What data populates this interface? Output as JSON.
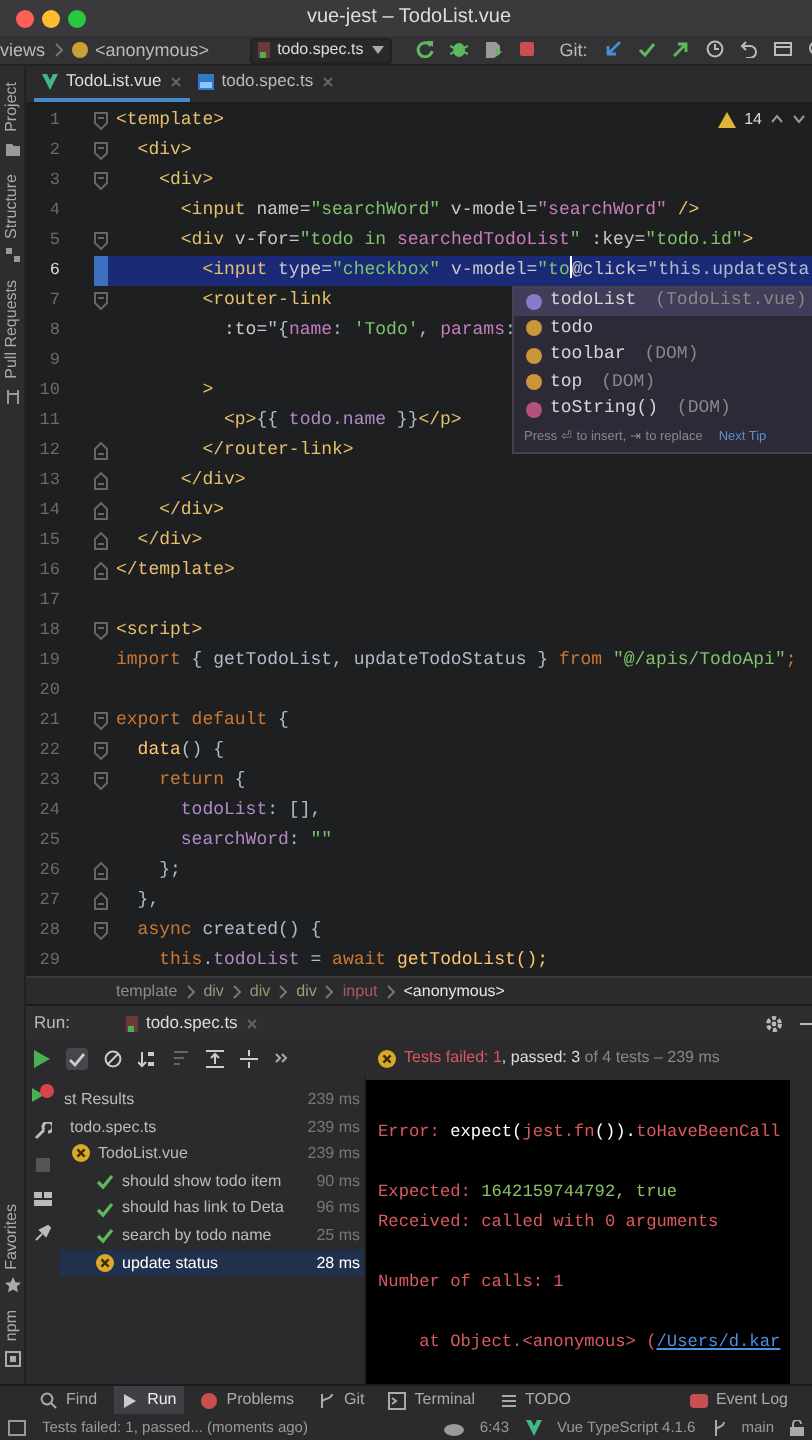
{
  "window": {
    "title": "vue-jest – TodoList.vue"
  },
  "toolbar": {
    "breadcrumb": [
      "views",
      "<anonymous>"
    ],
    "run_config": "todo.spec.ts",
    "git_label": "Git:"
  },
  "tool_strip": {
    "top": [
      "Project",
      "Structure",
      "Pull Requests"
    ],
    "bottom": [
      "Favorites",
      "npm"
    ]
  },
  "editor_tabs": [
    {
      "label": "TodoList.vue",
      "kind": "vue",
      "selected": true
    },
    {
      "label": "todo.spec.ts",
      "kind": "ts",
      "selected": false
    }
  ],
  "editor": {
    "warnings": "14",
    "lines": [
      {
        "number": "1",
        "kind": "fold-start",
        "current": false,
        "tokens": [
          {
            "text": "<template>",
            "kind": "tag"
          }
        ]
      },
      {
        "number": "2",
        "kind": "fold-start",
        "current": false,
        "tokens": [
          {
            "text": "  <div>",
            "kind": "tag"
          }
        ]
      },
      {
        "number": "3",
        "kind": "fold-start",
        "current": false,
        "tokens": [
          {
            "text": "    <div>",
            "kind": "tag"
          }
        ]
      },
      {
        "number": "4",
        "current": false,
        "tokens": [
          {
            "text": "      <input",
            "kind": "tag"
          },
          {
            "text": " name=",
            "kind": "attr"
          },
          {
            "text": "\"searchWord\"",
            "kind": "str"
          },
          {
            "text": " v-model=",
            "kind": "attr"
          },
          {
            "text": "\"searchWord\"",
            "kind": "bind"
          },
          {
            "text": " />",
            "kind": "tag"
          }
        ]
      },
      {
        "number": "5",
        "kind": "fold-start",
        "current": false,
        "tokens": [
          {
            "text": "      <div",
            "kind": "tag"
          },
          {
            "text": " v-for=",
            "kind": "attr"
          },
          {
            "text": "\"todo in ",
            "kind": "str"
          },
          {
            "text": "searchedTodoList",
            "kind": "bind"
          },
          {
            "text": "\"",
            "kind": "str"
          },
          {
            "text": " :key=",
            "kind": "attr"
          },
          {
            "text": "\"todo.id\"",
            "kind": "str"
          },
          {
            "text": ">",
            "kind": "tag"
          }
        ]
      },
      {
        "number": "6",
        "current": true,
        "tokens": [
          {
            "text": "        <input",
            "kind": "tag"
          },
          {
            "text": " type=",
            "kind": "attr"
          },
          {
            "text": "\"checkbox\"",
            "kind": "str"
          },
          {
            "text": " v-model=",
            "kind": "attr"
          },
          {
            "text": "\"to",
            "kind": "str"
          },
          {
            "kind": "caret"
          },
          {
            "text": "@click=",
            "kind": "attr"
          },
          {
            "text": "\"this.updateSta",
            "kind": "plain"
          }
        ]
      },
      {
        "number": "7",
        "kind": "fold-start",
        "current": false,
        "tokens": [
          {
            "text": "        <router-link",
            "kind": "tag"
          }
        ]
      },
      {
        "number": "8",
        "current": false,
        "tokens": [
          {
            "text": "          :to=",
            "kind": "attr"
          },
          {
            "text": "\"{",
            "kind": "plain"
          },
          {
            "text": "name",
            "kind": "bind"
          },
          {
            "text": ": ",
            "kind": "plain"
          },
          {
            "text": "'Todo'",
            "kind": "str"
          },
          {
            "text": ", ",
            "kind": "plain"
          },
          {
            "text": "params",
            "kind": "bind"
          },
          {
            "text": ":",
            "kind": "plain"
          }
        ]
      },
      {
        "number": "9",
        "current": false
      },
      {
        "number": "10",
        "current": false,
        "tokens": [
          {
            "text": "        >",
            "kind": "tag"
          }
        ]
      },
      {
        "number": "11",
        "current": false,
        "tokens": [
          {
            "text": "          <p>",
            "kind": "tag"
          },
          {
            "text": "{{ ",
            "kind": "plain"
          },
          {
            "text": "todo.name",
            "kind": "prop"
          },
          {
            "text": " }}",
            "kind": "plain"
          },
          {
            "text": "</p>",
            "kind": "tag"
          }
        ]
      },
      {
        "number": "12",
        "kind": "fold-end",
        "current": false,
        "tokens": [
          {
            "text": "        </router-link>",
            "kind": "tag"
          }
        ]
      },
      {
        "number": "13",
        "kind": "fold-end",
        "current": false,
        "tokens": [
          {
            "text": "      </div>",
            "kind": "tag"
          }
        ]
      },
      {
        "number": "14",
        "kind": "fold-end",
        "current": false,
        "tokens": [
          {
            "text": "    </div>",
            "kind": "tag"
          }
        ]
      },
      {
        "number": "15",
        "kind": "fold-end",
        "current": false,
        "tokens": [
          {
            "text": "  </div>",
            "kind": "tag"
          }
        ]
      },
      {
        "number": "16",
        "kind": "fold-end",
        "current": false,
        "tokens": [
          {
            "text": "</template>",
            "kind": "tag"
          }
        ]
      },
      {
        "number": "17",
        "current": false
      },
      {
        "number": "18",
        "kind": "fold-start",
        "current": false,
        "tokens": [
          {
            "text": "<script>",
            "kind": "tag"
          }
        ]
      },
      {
        "number": "19",
        "current": false,
        "tokens": [
          {
            "text": "import",
            "kind": "kw"
          },
          {
            "text": " { getTodoList, updateTodoStatus } ",
            "kind": "plain"
          },
          {
            "text": "from",
            "kind": "kw"
          },
          {
            "text": " \"@/apis/TodoApi\"",
            "kind": "str"
          },
          {
            "text": ";",
            "kind": "kw"
          }
        ]
      },
      {
        "number": "20",
        "current": false
      },
      {
        "number": "21",
        "kind": "fold-start",
        "current": false,
        "tokens": [
          {
            "text": "export default",
            "kind": "kw"
          },
          {
            "text": " {",
            "kind": "plain"
          }
        ]
      },
      {
        "number": "22",
        "kind": "fold-start",
        "current": false,
        "tokens": [
          {
            "text": "  data",
            "kind": "fn"
          },
          {
            "text": "() {",
            "kind": "plain"
          }
        ]
      },
      {
        "number": "23",
        "kind": "fold-start",
        "current": false,
        "tokens": [
          {
            "text": "    return",
            "kind": "kw"
          },
          {
            "text": " {",
            "kind": "plain"
          }
        ]
      },
      {
        "number": "24",
        "current": false,
        "tokens": [
          {
            "text": "      todoList",
            "kind": "prop"
          },
          {
            "text": ": [],",
            "kind": "plain"
          }
        ]
      },
      {
        "number": "25",
        "current": false,
        "tokens": [
          {
            "text": "      searchWord",
            "kind": "prop"
          },
          {
            "text": ": ",
            "kind": "plain"
          },
          {
            "text": "\"\"",
            "kind": "str"
          }
        ]
      },
      {
        "number": "26",
        "kind": "fold-end",
        "current": false,
        "tokens": [
          {
            "text": "    };",
            "kind": "plain"
          }
        ]
      },
      {
        "number": "27",
        "kind": "fold-end",
        "current": false,
        "tokens": [
          {
            "text": "  },",
            "kind": "plain"
          }
        ]
      },
      {
        "number": "28",
        "kind": "fold-start",
        "current": false,
        "tokens": [
          {
            "text": "  async",
            "kind": "kw"
          },
          {
            "text": " created() {",
            "kind": "plain"
          }
        ]
      },
      {
        "number": "29",
        "current": false,
        "tokens": [
          {
            "text": "    this",
            "kind": "kw"
          },
          {
            "text": ".",
            "kind": "plain"
          },
          {
            "text": "todoList",
            "kind": "prop"
          },
          {
            "text": " = ",
            "kind": "plain"
          },
          {
            "text": "await",
            "kind": "kw"
          },
          {
            "text": " getTodoList();",
            "kind": "fn"
          }
        ]
      }
    ],
    "autocomplete": {
      "items": [
        {
          "label": "todoList",
          "detail": "(TodoList.vue)",
          "kind": "property",
          "selected": true
        },
        {
          "label": "todo",
          "kind": "variable",
          "selected": false
        },
        {
          "label": "toolbar",
          "detail": "(DOM)",
          "kind": "variable",
          "selected": false
        },
        {
          "label": "top",
          "detail": "(DOM)",
          "kind": "variable",
          "selected": false
        },
        {
          "label": "toString()",
          "detail": "(DOM)",
          "kind": "method",
          "selected": false
        }
      ],
      "hint": "Press ⏎ to insert, ⇥ to replace",
      "tip_link": "Next Tip"
    }
  },
  "breadcrumb": [
    {
      "text": "template",
      "color": "#8c8c8c"
    },
    {
      "text": "div",
      "color": "#8f9a7c"
    },
    {
      "text": "div",
      "color": "#8aa06a"
    },
    {
      "text": "div",
      "color": "#9aa27a"
    },
    {
      "text": "input",
      "color": "#b05a5a"
    },
    {
      "text": "<anonymous>",
      "color": "#e6e6e6"
    }
  ],
  "run": {
    "label": "Run:",
    "tab": "todo.spec.ts",
    "summary": [
      {
        "text": "Tests failed: 1",
        "kind": "fail"
      },
      {
        "text": ", passed: 3",
        "kind": "pass"
      },
      {
        "text": " of 4 tests – 239 ms",
        "kind": "dim"
      }
    ],
    "tree": [
      {
        "label": "st Results",
        "time": "239 ms",
        "selected": false,
        "children": [
          {
            "label": "todo.spec.ts",
            "time": "239 ms",
            "selected": false,
            "children": [
              {
                "label": "TodoList.vue",
                "time": "239 ms",
                "kind": "failed",
                "selected": false,
                "children": [
                  {
                    "label": "should show todo item",
                    "time": "90 ms",
                    "kind": "passed",
                    "selected": false
                  },
                  {
                    "label": "should has link to Deta",
                    "time": "96 ms",
                    "kind": "passed",
                    "selected": false
                  },
                  {
                    "label": "search by todo name",
                    "time": "25 ms",
                    "kind": "passed",
                    "selected": false
                  },
                  {
                    "label": "update status",
                    "time": "28 ms",
                    "kind": "failed",
                    "selected": true
                  }
                ]
              }
            ]
          }
        ]
      }
    ],
    "console": [
      {
        "kind": "text",
        "tokens": [
          {
            "text": "Error: ",
            "kind": "err"
          },
          {
            "text": "expect(",
            "kind": "bright"
          },
          {
            "text": "jest.fn",
            "kind": "err"
          },
          {
            "text": "()).",
            "kind": "bright"
          },
          {
            "text": "toHaveBeenCall",
            "kind": "err"
          }
        ]
      },
      {
        "kind": "blank"
      },
      {
        "kind": "text",
        "tokens": [
          {
            "text": "Expected: ",
            "kind": "err"
          },
          {
            "text": "1642159744792, true",
            "kind": "num"
          }
        ]
      },
      {
        "kind": "text",
        "tokens": [
          {
            "text": "Received: called with 0 arguments",
            "kind": "err"
          }
        ]
      },
      {
        "kind": "blank"
      },
      {
        "kind": "text",
        "tokens": [
          {
            "text": "Number of calls: 1",
            "kind": "err"
          }
        ]
      },
      {
        "kind": "blank"
      },
      {
        "kind": "text",
        "tokens": [
          {
            "text": "    at Object.<anonymous> (",
            "kind": "err"
          },
          {
            "text": "/Users/d.kar",
            "kind": "link"
          }
        ]
      }
    ]
  },
  "tool_windows": [
    {
      "label": "Find",
      "kind": "find",
      "selected": false
    },
    {
      "label": "Run",
      "kind": "run",
      "selected": true
    },
    {
      "label": "Problems",
      "kind": "problems",
      "selected": false
    },
    {
      "label": "Git",
      "kind": "git",
      "selected": false
    },
    {
      "label": "Terminal",
      "kind": "terminal",
      "selected": false
    },
    {
      "label": "TODO",
      "kind": "todo",
      "selected": false
    },
    {
      "label": "Event Log",
      "kind": "log",
      "selected": false
    }
  ],
  "status_bar": {
    "message": "Tests failed: 1, passed... (moments ago)",
    "time": "6:43",
    "language": "Vue TypeScript 4.1.6",
    "branch": "main"
  }
}
